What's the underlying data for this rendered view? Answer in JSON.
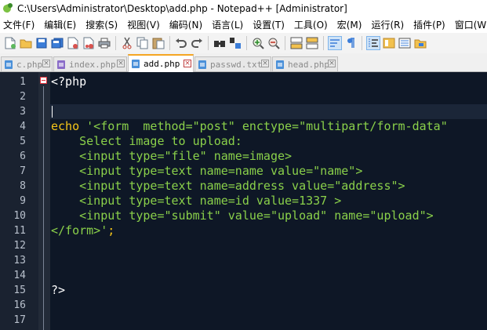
{
  "window": {
    "title": "C:\\Users\\Administrator\\Desktop\\add.php - Notepad++ [Administrator]"
  },
  "menu": [
    "文件(F)",
    "编辑(E)",
    "搜索(S)",
    "视图(V)",
    "编码(N)",
    "语言(L)",
    "设置(T)",
    "工具(O)",
    "宏(M)",
    "运行(R)",
    "插件(P)",
    "窗口(W)"
  ],
  "toolbar": {
    "icons": [
      "new-file-icon",
      "open-file-icon",
      "save-icon",
      "save-all-icon",
      "close-icon",
      "close-all-icon",
      "print-icon",
      "cut-icon",
      "copy-icon",
      "paste-icon",
      "undo-icon",
      "redo-icon",
      "find-icon",
      "replace-icon",
      "zoom-in-icon",
      "zoom-out-icon",
      "sync-v-icon",
      "sync-h-icon",
      "word-wrap-icon",
      "show-all-chars-icon",
      "indent-guide-icon",
      "doc-map-icon",
      "function-list-icon",
      "folder-workspace-icon"
    ]
  },
  "tabs": [
    {
      "label": "c.php",
      "active": false,
      "color": "#4a90d9"
    },
    {
      "label": "index.php",
      "active": false,
      "color": "#8a6cc8"
    },
    {
      "label": "add.php",
      "active": true,
      "color": "#4a90d9"
    },
    {
      "label": "passwd.txt",
      "active": false,
      "color": "#4a90d9"
    },
    {
      "label": "head.php",
      "active": false,
      "color": "#4a90d9"
    }
  ],
  "editor": {
    "line_numbers": [
      "1",
      "2",
      "3",
      "4",
      "5",
      "6",
      "7",
      "8",
      "9",
      "10",
      "11",
      "12",
      "13",
      "14",
      "15",
      "16",
      "17"
    ],
    "lines": [
      "<?php",
      "",
      "",
      "echo '<form  method=\"post\" enctype=\"multipart/form-data\"",
      "    Select image to upload:",
      "    <input type=\"file\" name=image>",
      "    <input type=text name=name value=\"name\">",
      "    <input type=text name=address value=\"address\">",
      "    <input type=text name=id value=1337 >",
      "    <input type=\"submit\" value=\"upload\" name=\"upload\">",
      "</form>';",
      "",
      "",
      "",
      "?>",
      "",
      ""
    ],
    "colors": {
      "background": "#0e1726",
      "string": "#8ad04a",
      "keyword": "#f5c518",
      "plain": "#ffffff"
    }
  }
}
